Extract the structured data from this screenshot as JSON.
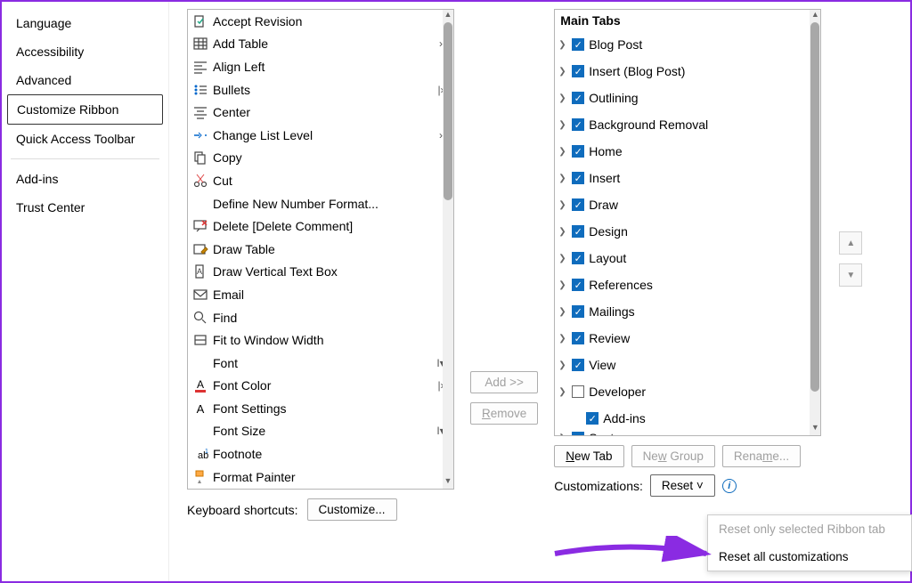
{
  "sidebar": {
    "items": [
      {
        "label": "Language",
        "selected": false
      },
      {
        "label": "Accessibility",
        "selected": false
      },
      {
        "label": "Advanced",
        "selected": false
      },
      {
        "label": "Customize Ribbon",
        "selected": true
      },
      {
        "label": "Quick Access Toolbar",
        "selected": false
      },
      {
        "label": "Add-ins",
        "selected": false
      },
      {
        "label": "Trust Center",
        "selected": false
      }
    ]
  },
  "commands": [
    {
      "label": "Accept Revision",
      "icon": "accept",
      "sub": ""
    },
    {
      "label": "Add Table",
      "icon": "table",
      "sub": "›"
    },
    {
      "label": "Align Left",
      "icon": "align-left",
      "sub": ""
    },
    {
      "label": "Bullets",
      "icon": "bullets",
      "sub": "|›"
    },
    {
      "label": "Center",
      "icon": "center",
      "sub": ""
    },
    {
      "label": "Change List Level",
      "icon": "list-level",
      "sub": "›"
    },
    {
      "label": "Copy",
      "icon": "copy",
      "sub": ""
    },
    {
      "label": "Cut",
      "icon": "cut",
      "sub": ""
    },
    {
      "label": "Define New Number Format...",
      "icon": "",
      "sub": ""
    },
    {
      "label": "Delete [Delete Comment]",
      "icon": "delete-comment",
      "sub": ""
    },
    {
      "label": "Draw Table",
      "icon": "draw-table",
      "sub": ""
    },
    {
      "label": "Draw Vertical Text Box",
      "icon": "vtext",
      "sub": ""
    },
    {
      "label": "Email",
      "icon": "email",
      "sub": ""
    },
    {
      "label": "Find",
      "icon": "find",
      "sub": ""
    },
    {
      "label": "Fit to Window Width",
      "icon": "fit",
      "sub": ""
    },
    {
      "label": "Font",
      "icon": "",
      "sub": "I▾"
    },
    {
      "label": "Font Color",
      "icon": "font-color",
      "sub": "|›"
    },
    {
      "label": "Font Settings",
      "icon": "font-settings",
      "sub": ""
    },
    {
      "label": "Font Size",
      "icon": "",
      "sub": "I▾"
    },
    {
      "label": "Footnote",
      "icon": "footnote",
      "sub": ""
    },
    {
      "label": "Format Painter",
      "icon": "painter",
      "sub": ""
    }
  ],
  "buttons": {
    "add": "Add >>",
    "remove": "<< Remove",
    "new_tab": "New Tab",
    "new_group": "New Group",
    "rename": "Rename...",
    "reset": "Reset",
    "customize": "Customize..."
  },
  "labels": {
    "kb_shortcuts": "Keyboard shortcuts:",
    "customizations": "Customizations:",
    "main_tabs": "Main Tabs"
  },
  "main_tabs": [
    {
      "label": "Blog Post",
      "checked": true,
      "expand": true
    },
    {
      "label": "Insert (Blog Post)",
      "checked": true,
      "expand": true
    },
    {
      "label": "Outlining",
      "checked": true,
      "expand": true
    },
    {
      "label": "Background Removal",
      "checked": true,
      "expand": true
    },
    {
      "label": "Home",
      "checked": true,
      "expand": true
    },
    {
      "label": "Insert",
      "checked": true,
      "expand": true
    },
    {
      "label": "Draw",
      "checked": true,
      "expand": true
    },
    {
      "label": "Design",
      "checked": true,
      "expand": true
    },
    {
      "label": "Layout",
      "checked": true,
      "expand": true
    },
    {
      "label": "References",
      "checked": true,
      "expand": true
    },
    {
      "label": "Mailings",
      "checked": true,
      "expand": true
    },
    {
      "label": "Review",
      "checked": true,
      "expand": true
    },
    {
      "label": "View",
      "checked": true,
      "expand": true
    },
    {
      "label": "Developer",
      "checked": false,
      "expand": true
    },
    {
      "label": "Add-ins",
      "checked": true,
      "expand": false,
      "indent": true
    },
    {
      "label": "Syntex",
      "checked": true,
      "expand": true,
      "clip": true
    }
  ],
  "reset_menu": {
    "item1": "Reset only selected Ribbon tab",
    "item2": "Reset all customizations"
  }
}
